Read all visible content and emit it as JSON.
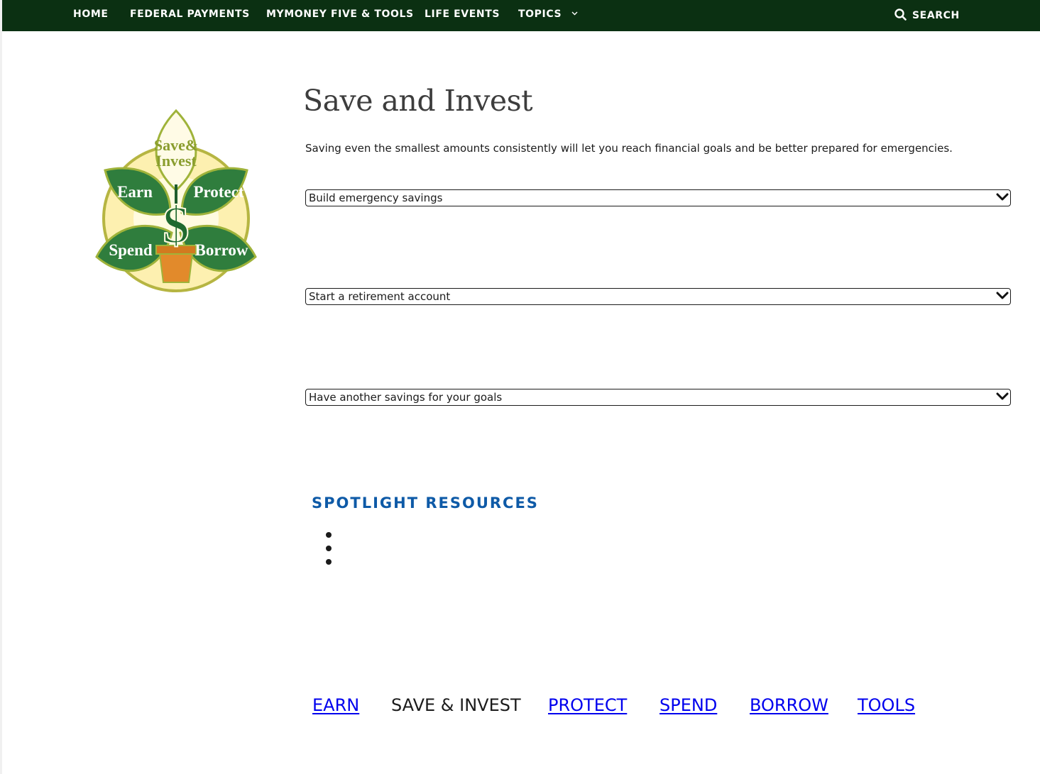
{
  "nav": {
    "items": [
      {
        "label": "HOME"
      },
      {
        "label": "FEDERAL PAYMENTS"
      },
      {
        "label": "MYMONEY FIVE & TOOLS"
      },
      {
        "label": "LIFE EVENTS"
      },
      {
        "label": "TOPICS"
      }
    ],
    "search_label": "SEARCH",
    "background": "#0b3012"
  },
  "logo": {
    "top": "Save&",
    "top2": "Invest",
    "left_upper": "Earn",
    "right_upper": "Protect",
    "left_lower": "Spend",
    "right_lower": "Borrow",
    "symbol": "$"
  },
  "main": {
    "title": "Save and Invest",
    "intro": "Saving even the smallest amounts consistently will let you reach financial goals and be better prepared for emergencies.",
    "accordions": [
      {
        "label": "Build emergency savings"
      },
      {
        "label": "Start a retirement account"
      },
      {
        "label": "Have another savings for your goals"
      }
    ]
  },
  "spotlight": {
    "title": "SPOTLIGHT RESOURCES",
    "title_color": "#0e5aa7"
  },
  "bottom_nav": {
    "items": [
      {
        "label": "EARN",
        "link": true
      },
      {
        "label": "SAVE & INVEST",
        "link": false
      },
      {
        "label": "PROTECT",
        "link": true
      },
      {
        "label": "SPEND",
        "link": true
      },
      {
        "label": "BORROW",
        "link": true
      },
      {
        "label": "TOOLS",
        "link": true
      }
    ],
    "link_color": "#0000ee"
  }
}
